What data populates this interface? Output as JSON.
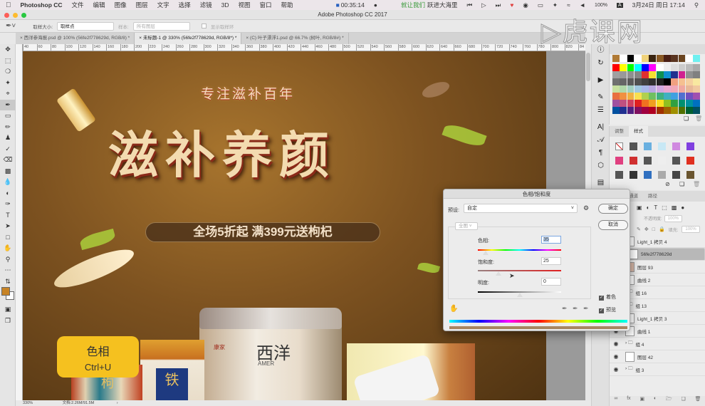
{
  "menubar": {
    "apple": "",
    "app": "Photoshop CC",
    "items": [
      "文件",
      "编辑",
      "图像",
      "图层",
      "文字",
      "选择",
      "滤镜",
      "3D",
      "视图",
      "窗口",
      "帮助"
    ],
    "recording_time": "00:35:14",
    "music_status": "就让我们",
    "music_title": "跃进大海里",
    "battery": "100%",
    "input_method": "A",
    "datetime": "3月24日 周日 17:14"
  },
  "window": {
    "title": "Adobe Photoshop CC 2017"
  },
  "watermark": "虎课网",
  "options": {
    "sample_size_label": "取样大小:",
    "sample_size_value": "取样点",
    "sample_label": "样本:",
    "sample_value": "所有图层",
    "show_ring_label": "显示取样环"
  },
  "tabs": [
    {
      "label": "西洋参海报.psd @ 100% (56fe2f778629d, RGB/8) *"
    },
    {
      "label": "未标题-1 @ 330% (56fe2f778629d, RGB/8*) *"
    },
    {
      "label": "(C) 叶子漂浮1.psd @ 66.7% (树叶, RGB/8#) *"
    }
  ],
  "ruler": [
    "40",
    "60",
    "80",
    "100",
    "120",
    "140",
    "160",
    "180",
    "200",
    "220",
    "240",
    "260",
    "280",
    "300",
    "320",
    "340",
    "360",
    "380",
    "400",
    "420",
    "440",
    "460",
    "480",
    "500",
    "520",
    "540",
    "560",
    "580",
    "600",
    "620",
    "640",
    "660",
    "680",
    "700",
    "720",
    "740",
    "760",
    "780",
    "800",
    "820",
    "84"
  ],
  "canvas": {
    "tagline": "专注滋补百年",
    "headline": "滋补养颜",
    "promo": "全场5折起 满399元送枸杞",
    "jar_label": "西洋",
    "jar_sub": "AMER",
    "brand": "康家",
    "box_char1": "枸",
    "box_char2": "铁"
  },
  "hint": {
    "title": "色相",
    "shortcut": "Ctrl+U"
  },
  "status": {
    "zoom": "330%",
    "doc": "文档:2.26M/91.5M"
  },
  "swatches": {
    "recent": [
      "#b07a35",
      "#ffffff",
      "#000000",
      "#ffffff",
      "#f0d27a",
      "#3a2410",
      "#8a5a25",
      "#4a2015",
      "#5a3520",
      "#6a4520",
      "#ffffff",
      "#6ef0f0"
    ],
    "grid": [
      "#ff0000",
      "#ffff00",
      "#00ff00",
      "#00ffff",
      "#0000ff",
      "#ff00ff",
      "#ffffff",
      "#eeeeee",
      "#dddddd",
      "#cccccc",
      "#bbbbbb",
      "#aaaaaa",
      "#a0a0a0",
      "#999999",
      "#8f8f8f",
      "#858585",
      "#e03030",
      "#f5e030",
      "#109050",
      "#1090d0",
      "#20308f",
      "#d0208f",
      "#909090",
      "#808080",
      "#707070",
      "#666666",
      "#5a5a5a",
      "#505050",
      "#404040",
      "#303030",
      "#202020",
      "#000000",
      "#f0a080",
      "#f5c090",
      "#f5d0a0",
      "#f8e8a0",
      "#c8e0a0",
      "#b0d8a8",
      "#a0d0c0",
      "#a0c8e0",
      "#a8b8e8",
      "#b8a8e0",
      "#d0a8e0",
      "#e8a8d0",
      "#f0a8b8",
      "#f0a8a0",
      "#e8b898",
      "#f0c8a0",
      "#e87040",
      "#f09040",
      "#f0b040",
      "#f8e050",
      "#b0d050",
      "#70c060",
      "#40b080",
      "#40b0c0",
      "#40a0e0",
      "#5070d0",
      "#7050c0",
      "#a050b0",
      "#a050a0",
      "#c05080",
      "#d04060",
      "#e02020",
      "#f07020",
      "#f0a020",
      "#f8e020",
      "#90c020",
      "#30a040",
      "#009070",
      "#0090a0",
      "#0070c0",
      "#0050a0",
      "#203090",
      "#502080",
      "#801060",
      "#a00040",
      "#b00020",
      "#a03000",
      "#a06000",
      "#a09000",
      "#507000",
      "#006030",
      "#005060"
    ]
  },
  "styles": {
    "tabs": [
      "调整",
      "样式"
    ],
    "active_tab": "样式",
    "colors": [
      "#ffffff",
      "#555555",
      "#6ab0e0",
      "#c8e8f5",
      "#d08ae0",
      "#8040e0",
      "#e04080",
      "#d03030",
      "#555555",
      "#eeeeee",
      "#555555",
      "#e03020",
      "#555555",
      "#333333",
      "#3070c0",
      "#aaaaaa",
      "#444444",
      "#6a5530"
    ]
  },
  "layers": {
    "tabs": [
      "通道",
      "路径"
    ],
    "opacity_label": "不透明度:",
    "opacity_value": "100%",
    "fill_label": "填充:",
    "fill_value": "100%",
    "items": [
      {
        "name": "Light_1 拷贝 4",
        "visible": false,
        "selected": false
      },
      {
        "name": "56fe2f778629d",
        "visible": false,
        "selected": true
      },
      {
        "name": "图层 93",
        "visible": false,
        "selected": false
      },
      {
        "name": "曲线 2",
        "visible": false,
        "selected": false
      },
      {
        "name": "组 16",
        "visible": false,
        "selected": false
      },
      {
        "name": "组 13",
        "visible": false,
        "selected": false
      },
      {
        "name": "Light_1 拷贝 3",
        "visible": false,
        "selected": false
      },
      {
        "name": "曲线 1",
        "visible": true,
        "selected": false
      },
      {
        "name": "组 4",
        "visible": true,
        "selected": false
      },
      {
        "name": "图层 42",
        "visible": true,
        "selected": false
      },
      {
        "name": "组 3",
        "visible": true,
        "selected": false
      }
    ]
  },
  "dialog": {
    "title": "色相/饱和度",
    "preset_label": "预设:",
    "preset_value": "自定",
    "ok": "确定",
    "cancel": "取消",
    "channel": "全图",
    "hue_label": "色相:",
    "hue_value": "35",
    "saturation_label": "饱和度:",
    "saturation_value": "25",
    "lightness_label": "明度:",
    "lightness_value": "0",
    "colorize_label": "着色",
    "colorize_checked": true,
    "preview_label": "预览",
    "preview_checked": true,
    "result_color": "#a88560"
  }
}
